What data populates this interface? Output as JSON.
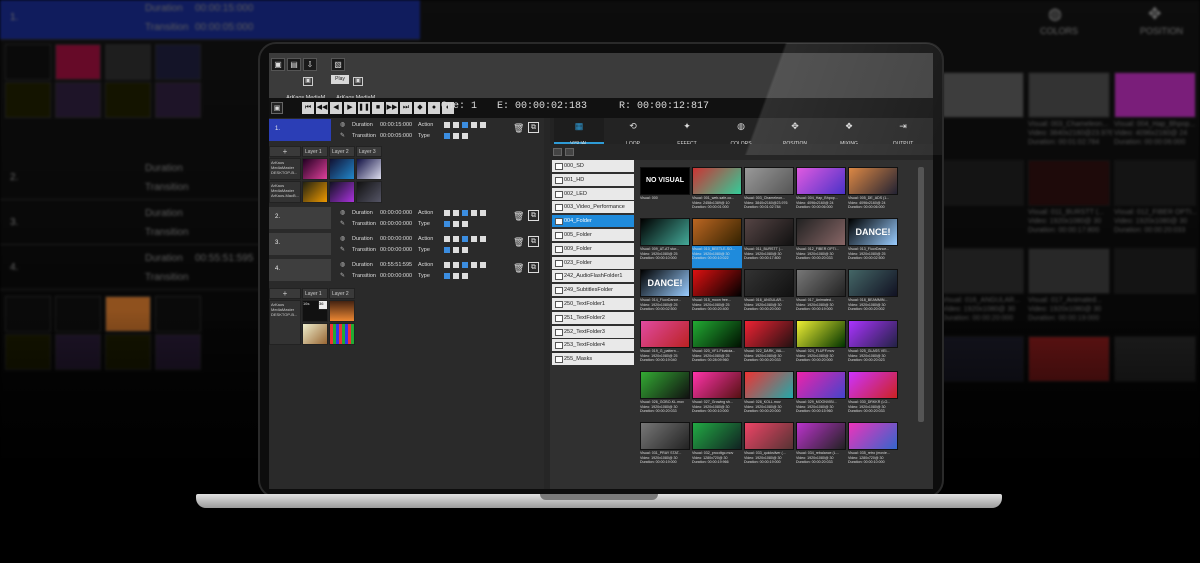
{
  "app": {
    "tooltip": "Play",
    "media_masters": [
      "ArKaos MediaM...",
      "ArKaos MediaM..."
    ]
  },
  "transport": {
    "cue_label": "Cue: 1",
    "elapsed_label": "E: 00:00:02:183",
    "remaining_label": "R: 00:00:12:817",
    "buttons": [
      "⏮",
      "◀◀",
      "◀",
      "▶",
      "❚❚",
      "■",
      "▶▶",
      "⏭",
      "◆",
      "●",
      "◐"
    ]
  },
  "cues": [
    {
      "num": "1.",
      "duration": "00:00:15:000",
      "transition": "00:00:05:000",
      "selected": true
    },
    {
      "num": "2.",
      "duration": "00:00:00:000",
      "transition": "00:00:00:000",
      "selected": false
    },
    {
      "num": "3.",
      "duration": "00:00:00:000",
      "transition": "00:00:00:000",
      "selected": false
    },
    {
      "num": "4.",
      "duration": "00:55:51:595",
      "transition": "00:00:00:000",
      "selected": false
    }
  ],
  "cue_labels": {
    "duration": "Duration",
    "transition": "Transition",
    "action": "Action",
    "type": "Type"
  },
  "layers": {
    "headers": [
      "Layer 1",
      "Layer 2",
      "Layer 3"
    ],
    "plus": "+",
    "device_text": "ArKaos MediaMaster DESKTOP-B...",
    "device_text2": "ArKaos MediaMaster ArKaos-MacB...",
    "layer4_header_16": "16s",
    "layer4_header_36": "36"
  },
  "tabs": [
    {
      "label": "VISUAL",
      "icon": "▦",
      "active": true
    },
    {
      "label": "LOOP",
      "icon": "⟲",
      "active": false
    },
    {
      "label": "EFFECT",
      "icon": "✦",
      "active": false
    },
    {
      "label": "COLORS",
      "icon": "◍",
      "active": false
    },
    {
      "label": "POSITION",
      "icon": "✥",
      "active": false
    },
    {
      "label": "MIXING",
      "icon": "❖",
      "active": false
    },
    {
      "label": "OUTPUT",
      "icon": "⇥",
      "active": false
    }
  ],
  "folders": [
    {
      "name": "000_SD",
      "selected": false
    },
    {
      "name": "001_HD",
      "selected": false
    },
    {
      "name": "002_LED",
      "selected": false
    },
    {
      "name": "003_Video_Performance",
      "selected": false
    },
    {
      "name": "004_Folder",
      "selected": true
    },
    {
      "name": "005_Folder",
      "selected": false
    },
    {
      "name": "009_Folder",
      "selected": false
    },
    {
      "name": "023_Folder",
      "selected": false
    },
    {
      "name": "242_AudioFlashFolder1",
      "selected": false
    },
    {
      "name": "249_SubtitlesFolder",
      "selected": false
    },
    {
      "name": "250_TextFolder1",
      "selected": false
    },
    {
      "name": "251_TextFolder2",
      "selected": false
    },
    {
      "name": "252_TextFolder3",
      "selected": false
    },
    {
      "name": "253_TextFolder4",
      "selected": false
    },
    {
      "name": "255_Masks",
      "selected": false
    }
  ],
  "visuals": [
    {
      "l1": "Visual: 000",
      "l2": "",
      "l3": "",
      "c1": "#000",
      "c2": "#000",
      "label": "NO VISUAL"
    },
    {
      "l1": "Visual: 001_web-safe-co...",
      "l2": "Video: 2458x1389@ 10",
      "l3": "Duration: 00:00:01:000",
      "c1": "#c33",
      "c2": "#3c9"
    },
    {
      "l1": "Visual: 003_Chameleon...",
      "l2": "Video: 3840x2160@23.976",
      "l3": "Duration: 00:01:02:784",
      "c1": "#999",
      "c2": "#555"
    },
    {
      "l1": "Visual: 004_Hap_Bhpop...",
      "l2": "Video: 4096x2160@ 24",
      "l3": "Duration: 00:00:06:000",
      "c1": "#e05ae0",
      "c2": "#4a32c8"
    },
    {
      "l1": "Visual: 005_DE_ADS (1...",
      "l2": "Video: 4096x2160@ 24",
      "l3": "Duration: 00:00:06:000",
      "c1": "#d84",
      "c2": "#223"
    },
    {
      "l1": "Visual: 009_AT-AT stor...",
      "l2": "Video: 1920x1080@ 25",
      "l3": "Duration: 00:00:10:000",
      "c1": "#000",
      "c2": "#4a9"
    },
    {
      "l1": "Visual: 010_BEETLE-SO...",
      "l2": "Video: 1920x1080@ 30",
      "l3": "Duration: 00:00:10:022",
      "c1": "#b62",
      "c2": "#320"
    },
    {
      "l1": "Visual: 011_BURSTT (...",
      "l2": "Video: 1920x1080@ 30",
      "l3": "Duration: 00:00:17:800",
      "c1": "#544",
      "c2": "#111"
    },
    {
      "l1": "Visual: 012_FIBER OPTI...",
      "l2": "Video: 1920x1080@ 30",
      "l3": "Duration: 00:00:20:033",
      "c1": "#222",
      "c2": "#866"
    },
    {
      "l1": "Visual: 013_FluorDance...",
      "l2": "Video: 1920x1080@ 25",
      "l3": "Duration: 00:00:02:500",
      "c1": "#000",
      "c2": "#9cf",
      "label": "DANCE!"
    },
    {
      "l1": "Visual: 014_FluorDance...",
      "l2": "Video: 1920x1080@ 25",
      "l3": "Duration: 00:00:02:500",
      "c1": "#000",
      "c2": "#9cf",
      "label": "DANCE!"
    },
    {
      "l1": "Visual: 015_moon free...",
      "l2": "Video: 1920x1080@ 25",
      "l3": "Duration: 00:00:20:400",
      "c1": "#d11",
      "c2": "#000"
    },
    {
      "l1": "Visual: 016_ANGULAR...",
      "l2": "Video: 1920x1080@ 30",
      "l3": "Duration: 00:00:20:000",
      "c1": "#333",
      "c2": "#111"
    },
    {
      "l1": "Visual: 017_Animated...",
      "l2": "Video: 1920x1080@ 30",
      "l3": "Duration: 00:00:19:000",
      "c1": "#777",
      "c2": "#222"
    },
    {
      "l1": "Visual: 018_BEAMMIN...",
      "l2": "Video: 1920x1080@ 30",
      "l3": "Duration: 00:00:20:002",
      "c1": "#466",
      "c2": "#112"
    },
    {
      "l1": "Visual: 019_G_pattern...",
      "l2": "Video: 1920x1080@ 25",
      "l3": "Duration: 00:00:19:040",
      "c1": "#e04aa0",
      "c2": "#b22"
    },
    {
      "l1": "Visual: 020_VF1-Floatoia...",
      "l2": "Video: 1920x1080@ 25",
      "l3": "Duration: 00:28:09:960",
      "c1": "#2a3",
      "c2": "#010"
    },
    {
      "l1": "Visual: 022_DARK_VAL...",
      "l2": "Video: 1920x1080@ 30",
      "l3": "Duration: 00:00:20:033",
      "c1": "#e23",
      "c2": "#211"
    },
    {
      "l1": "Visual: 024_FLUFF.mov",
      "l2": "Video: 1920x1080@ 30",
      "l3": "Duration: 00:00:20:000",
      "c1": "#ee3",
      "c2": "#030"
    },
    {
      "l1": "Visual: 025_GLASS VEI...",
      "l2": "Video: 1920x1080@ 30",
      "l3": "Duration: 00:00:20:023",
      "c1": "#a3f",
      "c2": "#224"
    },
    {
      "l1": "Visual: 026_GOBO-KL.mov",
      "l2": "Video: 1920x1080@ 30",
      "l3": "Duration: 00:00:20:033",
      "c1": "#3a3",
      "c2": "#111"
    },
    {
      "l1": "Visual: 027_Growing sh...",
      "l2": "Video: 1920x1080@ 30",
      "l3": "Duration: 00:00:10:000",
      "c1": "#f3a",
      "c2": "#511"
    },
    {
      "l1": "Visual: 028_KOLL.mov",
      "l2": "Video: 1920x1080@ 30",
      "l3": "Duration: 00:00:20:000",
      "c1": "#e33",
      "c2": "#2aa"
    },
    {
      "l1": "Visual: 029_MOONVIBI...",
      "l2": "Video: 1920x1080@ 30",
      "l3": "Duration: 00:00:15:960",
      "c1": "#e2a",
      "c2": "#44c"
    },
    {
      "l1": "Visual: 030_DRKKR (LO...",
      "l2": "Video: 1920x1080@ 30",
      "l3": "Duration: 00:00:20:033",
      "c1": "#c3f",
      "c2": "#c22"
    },
    {
      "l1": "Visual: 031_PRAY STAT...",
      "l2": "Video: 1920x1080@ 30",
      "l3": "Duration: 00:00:19:000",
      "c1": "#777",
      "c2": "#222"
    },
    {
      "l1": "Visual: 032_procdtgc.mov",
      "l2": "Video: 1280x720@ 30",
      "l3": "Duration: 00:00:19:966",
      "c1": "#2a4",
      "c2": "#122"
    },
    {
      "l1": "Visual: 033_quicksilver (...",
      "l2": "Video: 1920x1080@ 30",
      "l3": "Duration: 00:00:19:000",
      "c1": "#e46",
      "c2": "#533"
    },
    {
      "l1": "Visual: 034_rebalance (L...",
      "l2": "Video: 1920x1080@ 30",
      "l3": "Duration: 00:00:20:033",
      "c1": "#b3c",
      "c2": "#222"
    },
    {
      "l1": "Visual: 035_retro (movie...",
      "l2": "Video: 1280x720@ 30",
      "l3": "Duration: 00:00:10:000",
      "c1": "#e3b",
      "c2": "#36c"
    }
  ],
  "background": {
    "rows": [
      {
        "num": "1.",
        "k1": "Duration",
        "v1": "00:00:15:000",
        "k2": "Transition",
        "v2": "00:00:05:000"
      },
      {
        "num": "2.",
        "k1": "Duration",
        "v1": "",
        "k2": "Transition",
        "v2": ""
      },
      {
        "num": "3.",
        "k1": "Duration",
        "v1": "",
        "k2": "Transition",
        "v2": ""
      },
      {
        "num": "4.",
        "k1": "Duration",
        "v1": "00:55:51:595",
        "k2": "Transition",
        "v2": ""
      }
    ],
    "header_items": [
      {
        "label": "COLORS",
        "icon": "◍"
      },
      {
        "label": "POSITION",
        "icon": "✥"
      }
    ],
    "captions": [
      {
        "l1": "Visual: 003_Chameleon...",
        "l2": "Video: 3840x2160@23.976",
        "l3": "Duration: 00:01:02:784"
      },
      {
        "l1": "Visual: 004_Hap_Bhpop...",
        "l2": "Video: 4096x2160@ 24",
        "l3": "Duration: 00:00:06:000"
      },
      {
        "l1": "Visual: 011_BURSTT (...",
        "l2": "Video: 1920x1080@ 30",
        "l3": "Duration: 00:00:17:800"
      },
      {
        "l1": "Visual: 012_FIBER OPTI...",
        "l2": "Video: 1920x1080@ 30",
        "l3": "Duration: 00:00:20:033"
      },
      {
        "l1": "Visual: 016_ANGULAR...",
        "l2": "Video: 1920x1080@ 30",
        "l3": "Duration: 00:00:20:000"
      },
      {
        "l1": "Visual: 017_Animated...",
        "l2": "Video: 1920x1080@ 30",
        "l3": "Duration: 00:00:19:000"
      }
    ]
  }
}
